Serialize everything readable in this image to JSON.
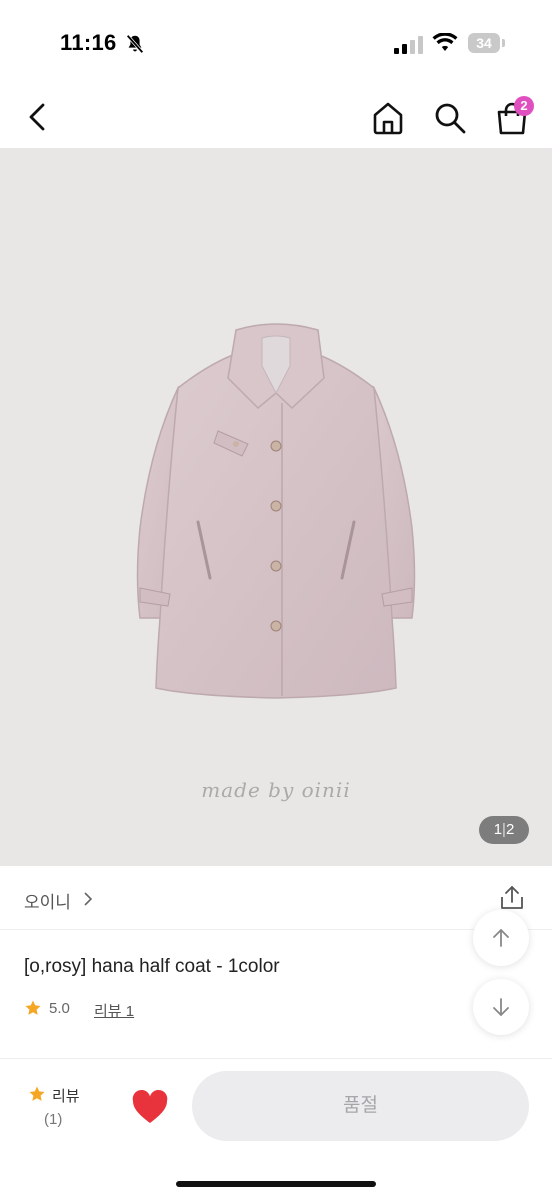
{
  "status_bar": {
    "time": "11:16",
    "battery": "34",
    "icons": [
      "bell-slash-icon",
      "signal-icon",
      "wifi-icon",
      "battery-icon"
    ]
  },
  "nav": {
    "icons": [
      "back-icon",
      "home-icon",
      "search-icon",
      "shopping-bag-icon"
    ],
    "cart_badge": "2"
  },
  "product_image": {
    "watermark": "made by oinii",
    "page_current": "1",
    "page_total": "2"
  },
  "brand": {
    "name": "오이니",
    "icons": [
      "chevron-right-icon",
      "share-icon"
    ]
  },
  "product": {
    "title": "[o,rosy] hana half coat - 1color",
    "rating": "5.0",
    "review_link": "리뷰 1"
  },
  "bottom_bar": {
    "review_label": "리뷰",
    "review_count": "(1)",
    "soldout_label": "품절"
  },
  "colors": {
    "badge": "#e04fc0",
    "star": "#f5a623",
    "heart": "#e8333c",
    "image_bg": "#e8e7e5",
    "soldout_bg": "#ececee"
  }
}
